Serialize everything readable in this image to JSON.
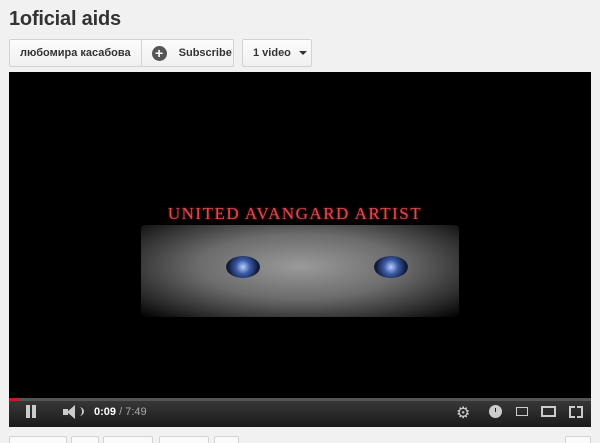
{
  "channel": {
    "title": "1oficial aids",
    "owner_name": "любомира касабова",
    "subscribe_label": "Subscribe",
    "subscribe_icon": "plus-circle-icon",
    "video_count_label": "1 video"
  },
  "player": {
    "banner_text": "UNITED AVANGARD ARTIST",
    "progress_fraction": 0.019,
    "current_time": "0:09",
    "separator": " / ",
    "total_time": "7:49",
    "accent_color": "#cc181e",
    "icons": [
      "pause-icon",
      "volume-icon",
      "settings-gear-icon",
      "watch-later-icon",
      "small-player-icon",
      "large-player-icon",
      "fullscreen-icon"
    ]
  }
}
